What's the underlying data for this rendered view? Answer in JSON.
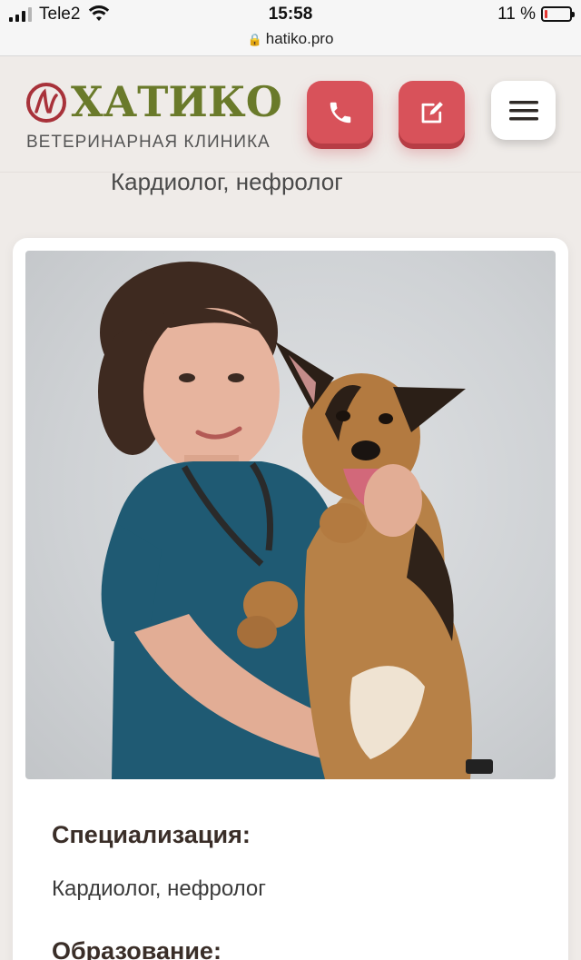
{
  "status_bar": {
    "carrier": "Tele2",
    "time": "15:58",
    "battery_percent": "11 %",
    "battery_level": 0.11,
    "url": "hatiko.pro"
  },
  "header": {
    "logo_text": "ХАТИКО",
    "logo_subtitle": "ВЕТЕРИНАРНАЯ КЛИНИКА",
    "brand_red": "#d8525a",
    "brand_green": "#6a7a2a"
  },
  "doctor": {
    "subtitle": "Кардиолог, нефролог",
    "specialization_label": "Специализация:",
    "specialization_value": "Кардиолог, нефролог",
    "education_label": "Образование:"
  },
  "icons": {
    "phone": "phone-icon",
    "form": "edit-form-icon",
    "menu": "hamburger-menu-icon"
  }
}
